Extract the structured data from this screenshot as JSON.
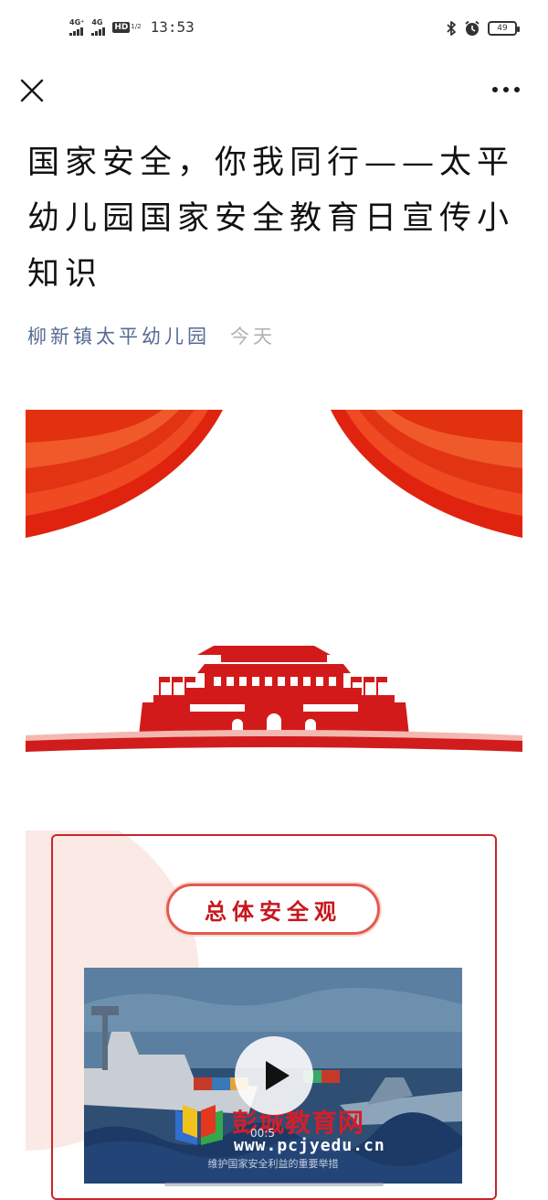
{
  "status_bar": {
    "signal1_label": "4G⁺",
    "signal2_label": "4G",
    "hd_label": "HD",
    "hd_fraction": "1/2",
    "time": "13:53",
    "battery_level": "49",
    "icons": [
      "bluetooth-icon",
      "alarm-icon",
      "battery-icon"
    ]
  },
  "nav": {
    "close_icon": "close-icon",
    "more_icon": "more-icon"
  },
  "article": {
    "title": "国家安全，你我同行——太平幼儿园国家安全教育日宣传小知识",
    "author": "柳新镇太平幼儿园",
    "date": "今天"
  },
  "content": {
    "section_heading": "总体安全观",
    "video": {
      "watermark_name": "彭城教育网",
      "watermark_url": "www.pcjyedu.cn",
      "time_label": "00:5",
      "subtitle": "维护国家安全利益的重要举措"
    }
  },
  "colors": {
    "accent_red": "#c8161d",
    "link_blue": "#576b95",
    "curtain_red": "#d92a14"
  }
}
